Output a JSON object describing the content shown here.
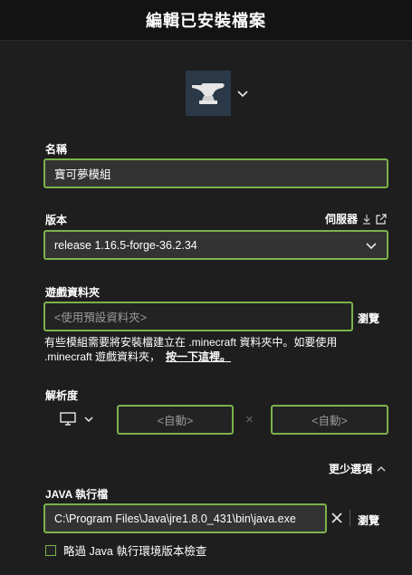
{
  "header": {
    "title": "編輯已安裝檔案"
  },
  "name": {
    "label": "名稱",
    "value": "寶可夢模組"
  },
  "version": {
    "label": "版本",
    "server_link": "伺服器",
    "selected": "release 1.16.5-forge-36.2.34"
  },
  "game_dir": {
    "label": "遊戲資料夾",
    "placeholder": "<使用預設資料夾>",
    "browse": "瀏覽",
    "help_text": "有些模組需要將安裝檔建立在 .minecraft 資料夾中。如要使用 .minecraft 遊戲資料夾，",
    "help_link": "按一下這裡。"
  },
  "resolution": {
    "label": "解析度",
    "width_placeholder": "<自動>",
    "height_placeholder": "<自動>",
    "separator": "×"
  },
  "more_options": {
    "label": "更少選項"
  },
  "java": {
    "label": "JAVA 執行檔",
    "path": "C:\\Program Files\\Java\\jre1.8.0_431\\bin\\java.exe",
    "browse": "瀏覽"
  },
  "skip_check": {
    "label": "略過 Java 執行環境版本檢查",
    "checked": false
  },
  "colors": {
    "accent": "#7bb34a",
    "background": "#1e1e1e",
    "header": "#131313"
  }
}
